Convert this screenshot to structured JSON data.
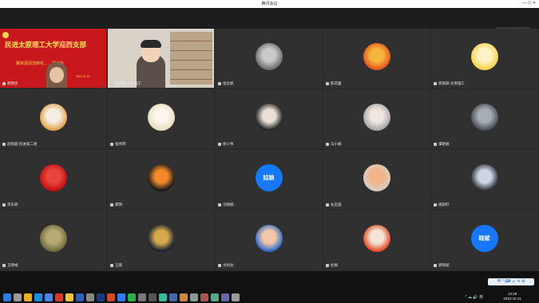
{
  "window": {
    "title": "腾讯会议",
    "controls": "— ☐ ✕"
  },
  "speaking": "正在讲话: 蔡彪彪",
  "banner": {
    "title": "民进太原理工大学迎西支部",
    "subtitle": "碳资源清洁转化……研讨会",
    "date": "2022-11-21"
  },
  "participants": [
    {
      "name": "郝明思",
      "type": "banner"
    },
    {
      "name": "杜新彪-太原理工",
      "type": "study"
    },
    {
      "name": "张云帆",
      "type": "image",
      "colors": [
        "#6d6d6d",
        "#c9c9c9"
      ]
    },
    {
      "name": "陈花蕾",
      "type": "image",
      "colors": [
        "#e2551e",
        "#f6b53c"
      ]
    },
    {
      "name": "郭丽丽-太原理工",
      "type": "image",
      "colors": [
        "#f5d34a",
        "#fff3c6"
      ]
    },
    {
      "name": "赵晓超-民进第二组",
      "type": "image",
      "colors": [
        "#e3a24c",
        "#f5efe3"
      ]
    },
    {
      "name": "张伟琴",
      "type": "image",
      "colors": [
        "#e8dcc0",
        "#fbf7ee"
      ]
    },
    {
      "name": "徐少伟",
      "type": "image",
      "colors": [
        "#222222",
        "#e8e0d6"
      ]
    },
    {
      "name": "马小楠",
      "type": "image",
      "colors": [
        "#a8a8a8",
        "#f0e6e0"
      ]
    },
    {
      "name": "谭艳娟",
      "type": "image",
      "colors": [
        "#4a4f55",
        "#a6aeb4"
      ]
    },
    {
      "name": "李乐君",
      "type": "image",
      "colors": [
        "#c40f14",
        "#e8463b"
      ]
    },
    {
      "name": "郝明",
      "type": "image",
      "colors": [
        "#15151a",
        "#f08a2b"
      ]
    },
    {
      "name": "马晓楠",
      "type": "text",
      "text": "姑娘"
    },
    {
      "name": "左志国",
      "type": "image",
      "colors": [
        "#d8cfc3",
        "#f2b48a"
      ]
    },
    {
      "name": "杨骄轩",
      "type": "image",
      "colors": [
        "#2b2f3a",
        "#cdd5e2"
      ]
    },
    {
      "name": "王晓彧",
      "type": "image",
      "colors": [
        "#6e6a3c",
        "#b7aa74"
      ]
    },
    {
      "name": "王薇",
      "type": "image",
      "colors": [
        "#142033",
        "#d8a94a"
      ]
    },
    {
      "name": "文利达",
      "type": "image",
      "colors": [
        "#2f6bc9",
        "#f2c7a8"
      ]
    },
    {
      "name": "杜梅",
      "type": "image",
      "colors": [
        "#e04a25",
        "#f2e5d8"
      ]
    },
    {
      "name": "郭晓斌",
      "type": "text",
      "text": "晓斌"
    }
  ],
  "taskbar": {
    "icons": [
      "windows-icon",
      "search-icon",
      "chrome-icon",
      "edge-icon",
      "files-icon",
      "wps-icon",
      "folder-icon",
      "word-icon",
      "app-icon",
      "photoshop-icon",
      "ppt-icon",
      "meeting-icon",
      "wechat-icon",
      "app-icon",
      "app-icon",
      "app-icon",
      "app-icon",
      "app-icon",
      "app-icon",
      "app-icon",
      "app-icon",
      "app-icon",
      "app-icon"
    ],
    "ime": "中 ° ⌨ ☺ ✎ ⚙",
    "time": "13:29",
    "date": "2022-11-21",
    "tray": "^ ☁ 🔊 英"
  }
}
